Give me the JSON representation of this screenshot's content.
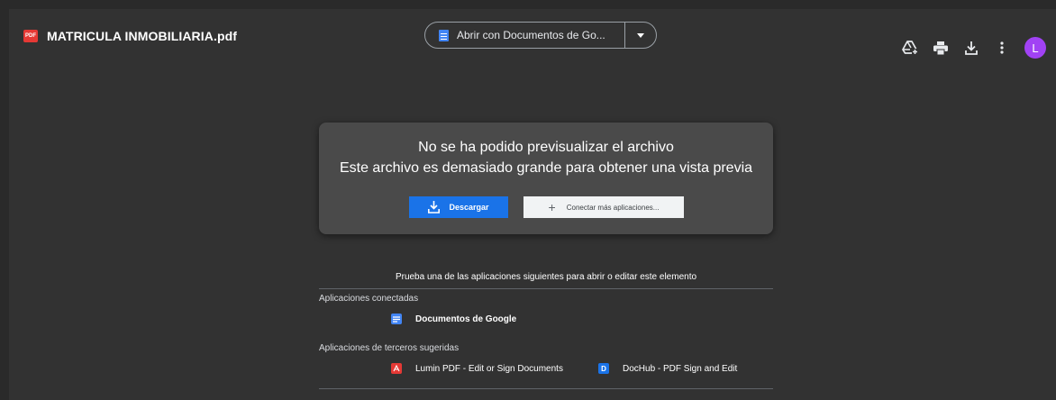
{
  "header": {
    "file_badge": "PDF",
    "file_name": "MATRICULA INMOBILIARIA.pdf",
    "open_with_label": "Abrir con Documentos de Go...",
    "open_with_icon": "google-docs-icon",
    "actions": [
      {
        "name": "add-to-drive",
        "icon": "add-to-drive-icon"
      },
      {
        "name": "print",
        "icon": "printer-icon"
      },
      {
        "name": "download",
        "icon": "download-icon"
      },
      {
        "name": "more",
        "icon": "more-vert-icon"
      }
    ],
    "avatar_initial": "L",
    "avatar_color": "#a142f4"
  },
  "preview": {
    "title": "No se ha podido previsualizar el archivo",
    "subtitle": "Este archivo es demasiado grande para obtener una vista previa",
    "download_label": "Descargar",
    "connect_label": "Conectar más aplicaciones..."
  },
  "suggestions": {
    "intro": "Prueba una de las aplicaciones siguientes para abrir o editar este elemento",
    "connected_label": "Aplicaciones conectadas",
    "connected_apps": [
      {
        "name": "Documentos de Google",
        "icon": "google-docs-icon",
        "color": "#4285f4"
      }
    ],
    "third_party_label": "Aplicaciones de terceros sugeridas",
    "third_party_apps": [
      {
        "name": "Lumin PDF - Edit or Sign Documents",
        "icon": "lumin-pdf-icon",
        "color": "#e53935"
      },
      {
        "name": "DocHub - PDF Sign and Edit",
        "icon": "dochub-icon",
        "color": "#1a73e8",
        "glyph": "D"
      }
    ]
  },
  "colors": {
    "background": "#323232",
    "card": "#4a4a4a",
    "accent": "#1a73e8"
  }
}
